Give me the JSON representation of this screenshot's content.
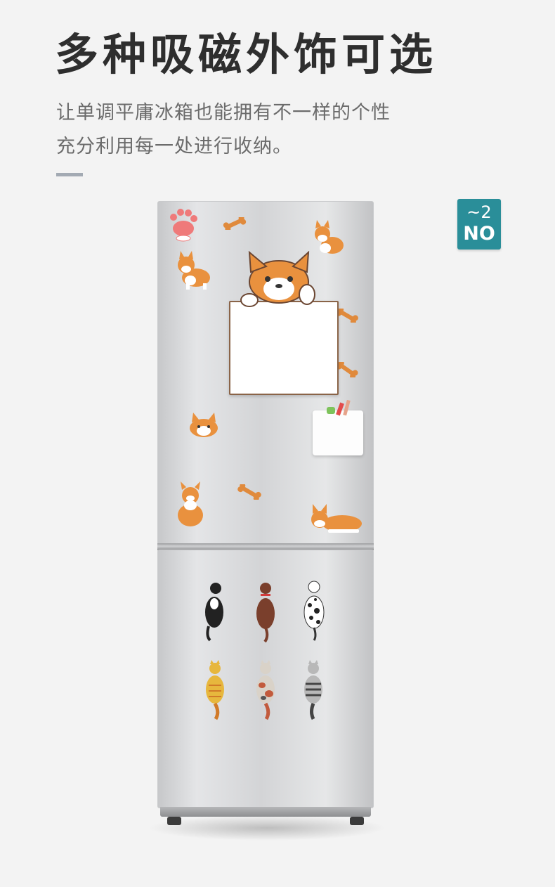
{
  "header": {
    "title": "多种吸磁外饰可选",
    "line1": "让单调平庸冰箱也能拥有不一样的个性",
    "line2": "充分利用每一处进行收纳。"
  },
  "badge": {
    "number": "~2",
    "label": "NO"
  },
  "colors": {
    "accent": "#2a8e99",
    "title": "#2e2e2e",
    "body_text": "#6b6b6b",
    "rule": "#a3aab3",
    "corgi_orange": "#e9913e",
    "bone": "#e08a3c",
    "board_frame": "#8a6448"
  },
  "fridge": {
    "upper_door_items": [
      "paw-sticker",
      "corgi-sticker",
      "bone-sticker",
      "corgi-whiteboard",
      "storage-pocket"
    ],
    "lower_door_items": [
      "black-dog-magnet",
      "brown-dog-magnet",
      "dalmatian-magnet",
      "orange-cat-magnet",
      "calico-cat-magnet",
      "gray-tabby-magnet"
    ]
  }
}
